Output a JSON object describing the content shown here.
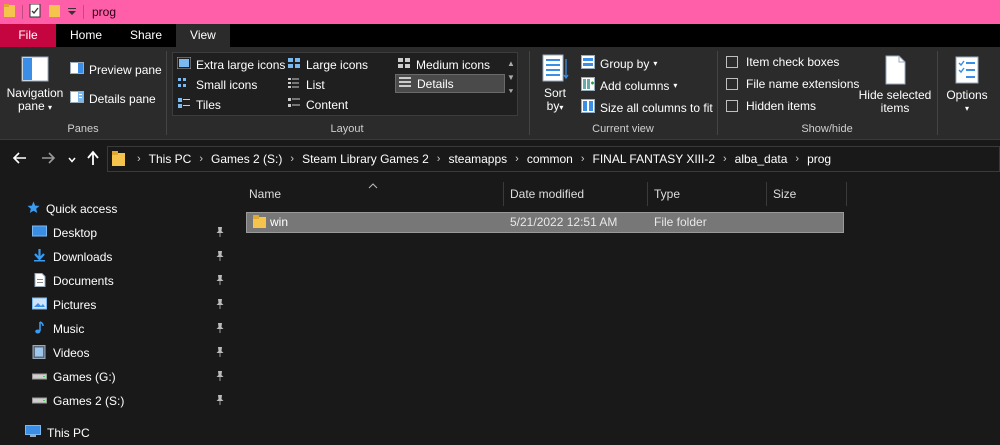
{
  "window": {
    "title": "prog"
  },
  "tabs": [
    "File",
    "Home",
    "Share",
    "View"
  ],
  "ribbon": {
    "panes": {
      "navigation_pane": "Navigation pane",
      "navigation_pane_line1": "Navigation",
      "navigation_pane_line2": "pane",
      "preview_pane": "Preview pane",
      "details_pane": "Details pane",
      "label": "Panes"
    },
    "layout": {
      "extra_large_icons": "Extra large icons",
      "large_icons": "Large icons",
      "medium_icons": "Medium icons",
      "small_icons": "Small icons",
      "list": "List",
      "details": "Details",
      "tiles": "Tiles",
      "content": "Content",
      "label": "Layout"
    },
    "current_view": {
      "sort_by_line1": "Sort",
      "sort_by_line2": "by",
      "group_by": "Group by",
      "add_columns": "Add columns",
      "size_all_columns": "Size all columns to fit",
      "label": "Current view"
    },
    "show_hide": {
      "item_check_boxes": "Item check boxes",
      "file_name_extensions": "File name extensions",
      "hidden_items": "Hidden items",
      "hide_selected_line1": "Hide selected",
      "hide_selected_line2": "items",
      "label": "Show/hide"
    },
    "options": {
      "label": "Options"
    }
  },
  "breadcrumb": [
    "This PC",
    "Games 2 (S:)",
    "Steam Library Games 2",
    "steamapps",
    "common",
    "FINAL FANTASY XIII-2",
    "alba_data",
    "prog"
  ],
  "sidebar": {
    "quick_access": "Quick access",
    "items": [
      {
        "label": "Desktop",
        "icon": "desktop-icon"
      },
      {
        "label": "Downloads",
        "icon": "downloads-icon"
      },
      {
        "label": "Documents",
        "icon": "documents-icon"
      },
      {
        "label": "Pictures",
        "icon": "pictures-icon"
      },
      {
        "label": "Music",
        "icon": "music-icon"
      },
      {
        "label": "Videos",
        "icon": "videos-icon"
      },
      {
        "label": "Games (G:)",
        "icon": "drive-icon"
      },
      {
        "label": "Games 2 (S:)",
        "icon": "drive-icon"
      }
    ],
    "this_pc": "This PC"
  },
  "columns": {
    "name": "Name",
    "date_modified": "Date modified",
    "type": "Type",
    "size": "Size"
  },
  "files": [
    {
      "name": "win",
      "date_modified": "5/21/2022 12:51 AM",
      "type": "File folder",
      "size": ""
    }
  ],
  "colors": {
    "titlebar": "#ff5fa8",
    "file_tab": "#c40540",
    "ribbon": "#2b2b2b",
    "background": "#191919",
    "selection": "#777777"
  }
}
